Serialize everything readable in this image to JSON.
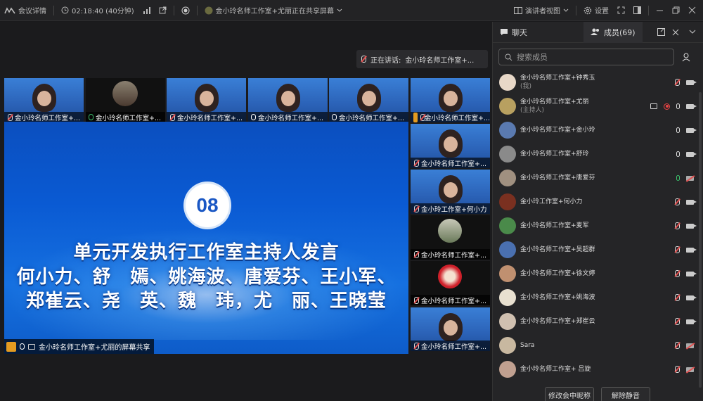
{
  "topbar": {
    "meeting_info": "会议详情",
    "duration": "02:18:40 (40分钟)",
    "share_status": "金小玲名师工作室+尤丽正在共享屏幕",
    "view": "演讲者视图",
    "settings": "设置"
  },
  "speaking": {
    "label": "正在讲话:",
    "name": "金小玲名师工作室+..."
  },
  "tiles_top": [
    {
      "label": "金小玲名师工作室+..."
    },
    {
      "label": "金小玲名师工作室+..."
    },
    {
      "label": "金小玲名师工作室+..."
    },
    {
      "label": "金小玲名师工作室+..."
    },
    {
      "label": "金小玲名师工作室+..."
    },
    {
      "label": "金小玲名师工作室+..."
    }
  ],
  "tiles_side": [
    {
      "label": "金小玲名师工作室+..."
    },
    {
      "label": "金小玲工作室+何小力"
    },
    {
      "label": "金小玲名师工作室+..."
    },
    {
      "label": "金小玲名师工作室+..."
    },
    {
      "label": "金小玲名师工作室+..."
    }
  ],
  "slide": {
    "number": "08",
    "title": "单元开发执行工作室主持人发言",
    "line2": "何小力、舒　嫣、姚海波、唐爱芬、王小军、",
    "line3": "郑崔云、尧　英、魏　玮，尤　丽、王晓莹"
  },
  "share_label": "金小玲名师工作室+尤丽的屏幕共享",
  "panel": {
    "tab_chat": "聊天",
    "tab_members": "成员(69)",
    "search_placeholder": "搜索成员",
    "members": [
      {
        "name": "金小玲名师工作室+钟秀玉",
        "sub": "(我)"
      },
      {
        "name": "金小玲名师工作室+尤丽",
        "sub": "(主持人)"
      },
      {
        "name": "金小玲名师工作室+金小玲",
        "sub": ""
      },
      {
        "name": "金小玲名师工作室+舒玲",
        "sub": ""
      },
      {
        "name": "金小玲名师工作室+唐爱芬",
        "sub": ""
      },
      {
        "name": "金小玲工作室+何小力",
        "sub": ""
      },
      {
        "name": "金小玲名师工作室+麦军",
        "sub": ""
      },
      {
        "name": "金小玲名师工作室+吴超群",
        "sub": ""
      },
      {
        "name": "金小玲名师工作室+徐文婷",
        "sub": ""
      },
      {
        "name": "金小玲名师工作室+姚海波",
        "sub": ""
      },
      {
        "name": "金小玲名师工作室+郑崔云",
        "sub": ""
      },
      {
        "name": "Sara",
        "sub": ""
      },
      {
        "name": "金小玲名师工作室+ 吕旋",
        "sub": ""
      }
    ],
    "btn_rename": "修改会中昵称",
    "btn_unmute": "解除静音"
  }
}
